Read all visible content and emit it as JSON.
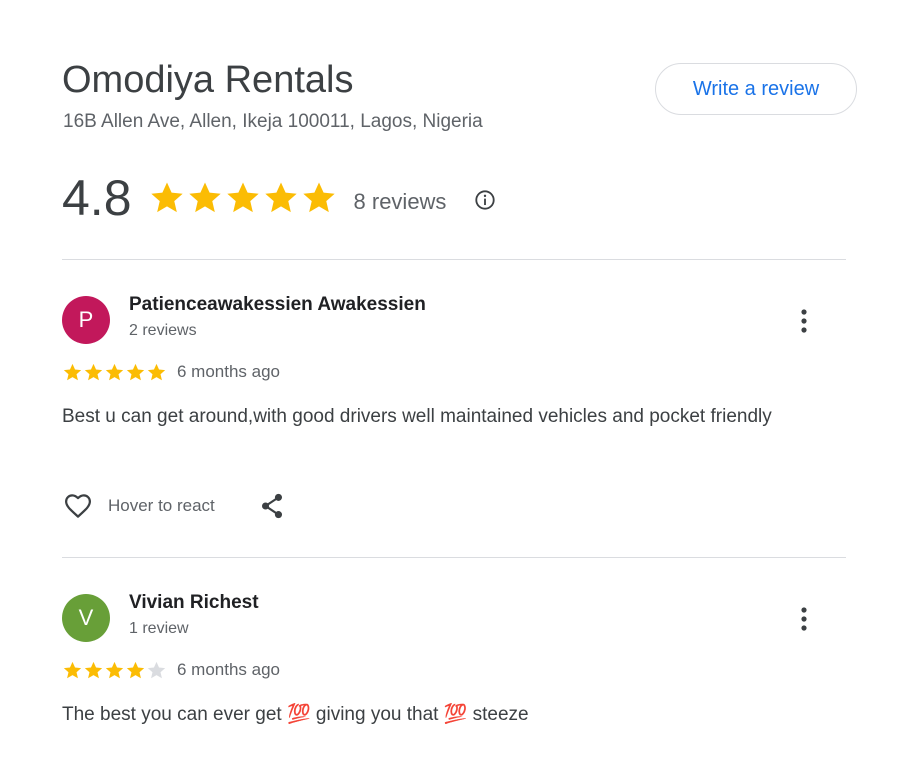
{
  "business": {
    "name": "Omodiya Rentals",
    "address": "16B Allen Ave, Allen, Ikeja 100011, Lagos, Nigeria",
    "write_review_label": "Write a review",
    "rating": "4.8",
    "rating_value": 4.8,
    "stars_max": 5,
    "reviews_count": "8 reviews"
  },
  "reviews": [
    {
      "initial": "P",
      "avatar_color": "#c2185b",
      "author": "Patienceawakessien Awakessien",
      "author_reviews": "2 reviews",
      "rating": 5,
      "time_ago": "6 months ago",
      "text": "Best u can get around,with good drivers well maintained vehicles and pocket friendly",
      "react_label": "Hover to react"
    },
    {
      "initial": "V",
      "avatar_color": "#689f38",
      "author": "Vivian Richest",
      "author_reviews": "1 review",
      "rating": 4,
      "time_ago": "6 months ago",
      "text": "The best you can ever get 💯 giving you that 💯 steeze"
    }
  ],
  "colors": {
    "star_filled": "#fbbc04",
    "star_empty": "#dadce0",
    "accent": "#1a73e8"
  }
}
